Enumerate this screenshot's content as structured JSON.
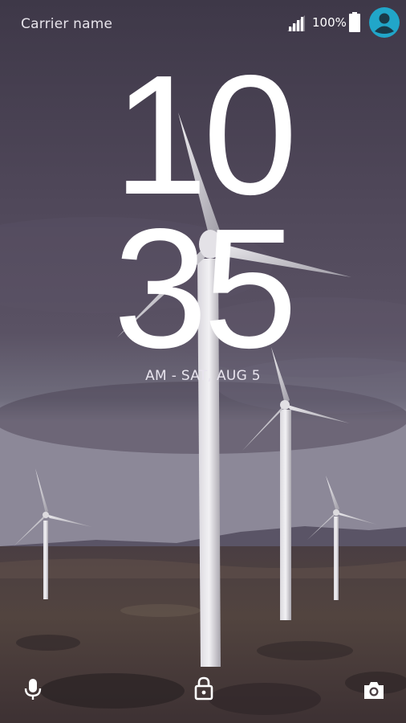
{
  "status_bar": {
    "carrier": "Carrier name",
    "battery_percent": "100%",
    "battery_level": 1.0,
    "signal_icon": "signal-icon",
    "battery_icon": "battery-full-icon",
    "avatar_icon": "user-avatar-icon",
    "avatar_color": "#21a6c9"
  },
  "lockscreen": {
    "clock_hours": "10",
    "clock_minutes": "35",
    "date": "AM - SAT, AUG 5"
  },
  "shortcuts": {
    "left_icon": "microphone-icon",
    "center_icon": "unlock-icon",
    "right_icon": "camera-icon"
  },
  "wallpaper": {
    "description_colors": {
      "sky": "#4d4557",
      "ground": "#45383a"
    }
  }
}
